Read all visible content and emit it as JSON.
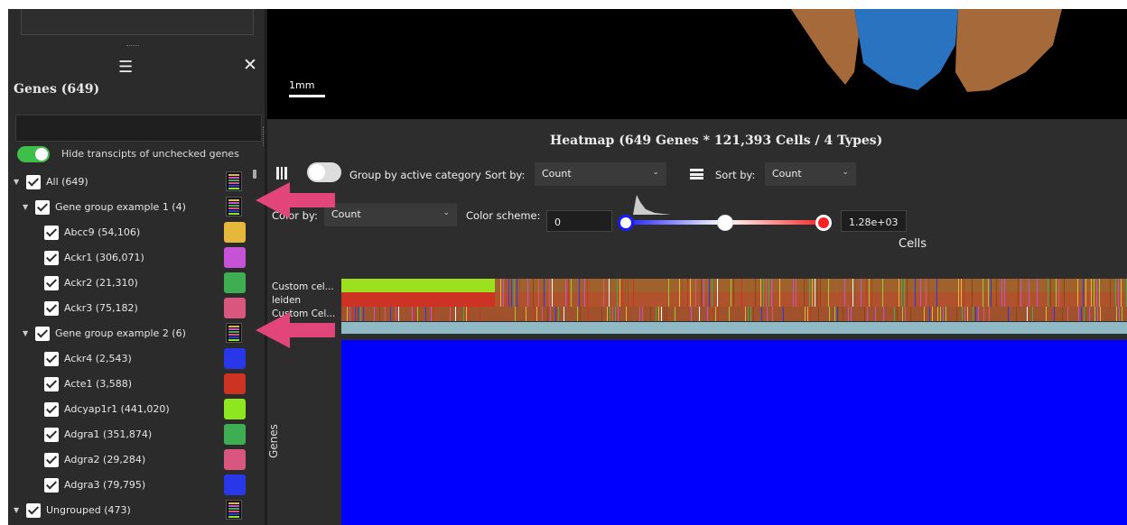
{
  "panel": {
    "title": "Genes (649)",
    "search_value": "",
    "hide_toggle_label": "Hide transcipts of unchecked genes",
    "hide_toggle_on": true
  },
  "gene_tree": [
    {
      "label": "All (649)",
      "level": 0,
      "caret": true,
      "multi": true
    },
    {
      "label": "Gene group example 1 (4)",
      "level": 1,
      "caret": true,
      "multi": true
    },
    {
      "label": "Abcc9 (54,106)",
      "level": 2,
      "color": "#e5b73b"
    },
    {
      "label": "Ackr1 (306,071)",
      "level": 2,
      "color": "#c653d6"
    },
    {
      "label": "Ackr2 (21,310)",
      "level": 2,
      "color": "#3fae52"
    },
    {
      "label": "Ackr3 (75,182)",
      "level": 2,
      "color": "#d9577f"
    },
    {
      "label": "Gene group example 2 (6)",
      "level": 1,
      "caret": true,
      "multi": true
    },
    {
      "label": "Ackr4 (2,543)",
      "level": 2,
      "color": "#2838e8"
    },
    {
      "label": "Acte1 (3,588)",
      "level": 2,
      "color": "#cc3322"
    },
    {
      "label": "Adcyap1r1 (441,020)",
      "level": 2,
      "color": "#8de61f"
    },
    {
      "label": "Adgra1 (351,874)",
      "level": 2,
      "color": "#3fae52"
    },
    {
      "label": "Adgra2 (29,284)",
      "level": 2,
      "color": "#d9577f"
    },
    {
      "label": "Adgra3 (79,795)",
      "level": 2,
      "color": "#2838e8"
    },
    {
      "label": "Ungrouped (473)",
      "level": 0,
      "caret": true,
      "multi": true
    }
  ],
  "image_view": {
    "scale_label": "1mm"
  },
  "heatmap": {
    "title": "Heatmap (649 Genes * 121,393 Cells / 4 Types)",
    "group_label": "Group by active category",
    "sort_label_1": "Sort by:",
    "sort_value_1": "Count",
    "sort_label_2": "Sort by:",
    "sort_value_2": "Count",
    "color_by_label": "Color by:",
    "color_by_value": "Count",
    "color_scheme_label": "Color scheme:",
    "scale_min": "0",
    "scale_max": "1.28e+03",
    "cells_label": "Cells",
    "genes_label": "Genes",
    "track_labels": [
      "Custom cel...",
      "leiden",
      "Custom Cel..."
    ]
  },
  "colors": {
    "heatmap_fill": "#0000ff",
    "accent_green": "#3fbf4a",
    "arrow_pink": "#e2457a",
    "spatial_orange": "#b8743f",
    "spatial_blue": "#2f7fd6"
  }
}
